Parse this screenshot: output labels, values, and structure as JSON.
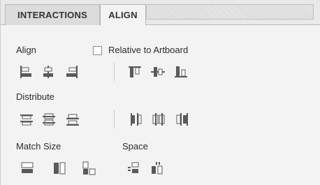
{
  "tabs": [
    {
      "label": "INTERACTIONS"
    },
    {
      "label": "ALIGN"
    }
  ],
  "align": {
    "section_label": "Align",
    "relative_label": "Relative to Artboard",
    "relative_checked": false
  },
  "distribute": {
    "section_label": "Distribute"
  },
  "match_size": {
    "section_label": "Match Size"
  },
  "space": {
    "section_label": "Space"
  },
  "colors": {
    "icon": "#5a5a5a",
    "icon_light": "#ffffff",
    "background": "#f3f3f3"
  }
}
